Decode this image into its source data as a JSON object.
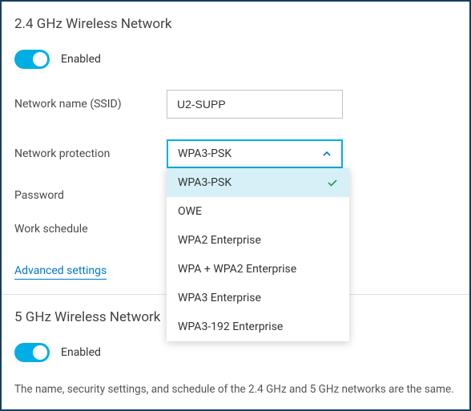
{
  "section24": {
    "title": "2.4 GHz Wireless Network",
    "enabled_label": "Enabled",
    "fields": {
      "ssid_label": "Network name (SSID)",
      "ssid_value": "U2-SUPP",
      "protection_label": "Network protection",
      "protection_value": "WPA3-PSK",
      "password_label": "Password",
      "schedule_label": "Work schedule"
    },
    "protection_options": [
      "WPA3-PSK",
      "OWE",
      "WPA2 Enterprise",
      "WPA + WPA2 Enterprise",
      "WPA3 Enterprise",
      "WPA3-192 Enterprise"
    ],
    "advanced_link": "Advanced settings"
  },
  "section5": {
    "title": "5 GHz Wireless Network",
    "enabled_label": "Enabled",
    "note": "The name, security settings, and schedule of the 2.4 GHz and 5 GHz networks are the same."
  },
  "colors": {
    "accent": "#00aee6",
    "link": "#0078c8",
    "border_dark": "#1a3d5c"
  }
}
